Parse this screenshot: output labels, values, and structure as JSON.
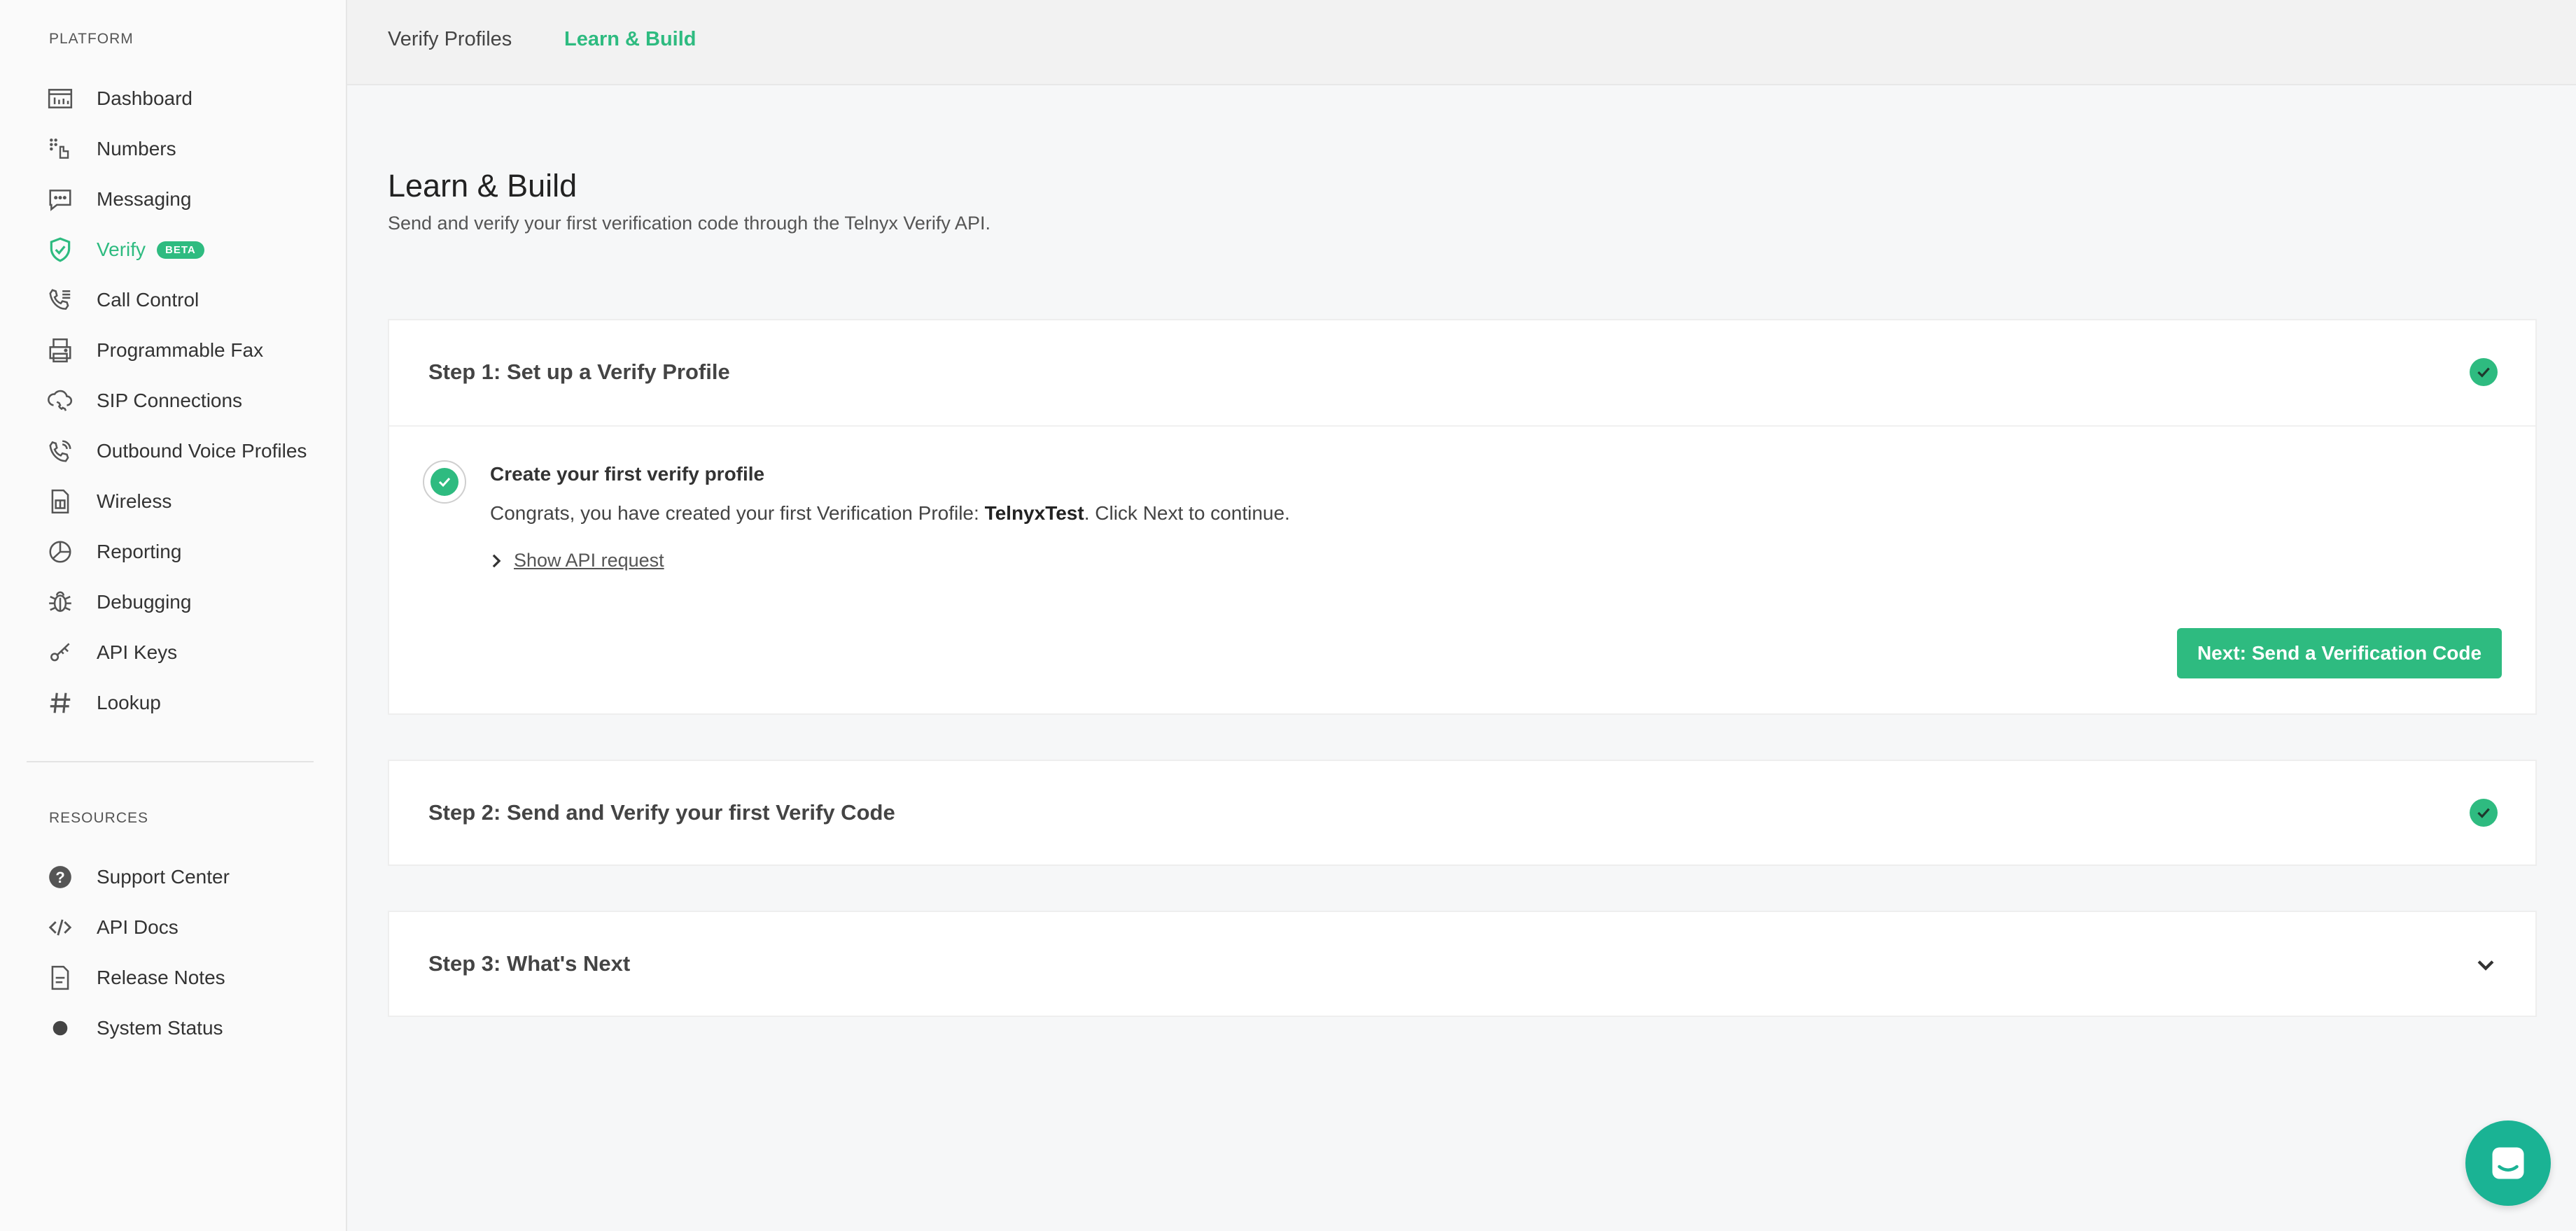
{
  "sidebar": {
    "platform_title": "PLATFORM",
    "items": [
      {
        "label": "Dashboard",
        "icon": "dashboard-icon"
      },
      {
        "label": "Numbers",
        "icon": "numbers-icon"
      },
      {
        "label": "Messaging",
        "icon": "messaging-icon"
      },
      {
        "label": "Verify",
        "icon": "verify-shield-icon",
        "badge": "BETA",
        "active": true
      },
      {
        "label": "Call Control",
        "icon": "call-control-icon"
      },
      {
        "label": "Programmable Fax",
        "icon": "fax-icon"
      },
      {
        "label": "SIP Connections",
        "icon": "sip-connections-icon"
      },
      {
        "label": "Outbound Voice Profiles",
        "icon": "outbound-voice-icon"
      },
      {
        "label": "Wireless",
        "icon": "wireless-sim-icon"
      },
      {
        "label": "Reporting",
        "icon": "reporting-pie-icon"
      },
      {
        "label": "Debugging",
        "icon": "debugging-bug-icon"
      },
      {
        "label": "API Keys",
        "icon": "api-keys-icon"
      },
      {
        "label": "Lookup",
        "icon": "lookup-hash-icon"
      }
    ],
    "resources_title": "RESOURCES",
    "resources": [
      {
        "label": "Support Center",
        "icon": "support-question-icon"
      },
      {
        "label": "API Docs",
        "icon": "code-icon"
      },
      {
        "label": "Release Notes",
        "icon": "document-icon"
      },
      {
        "label": "System Status",
        "icon": "status-dot-icon"
      }
    ]
  },
  "topbar": {
    "tabs": [
      {
        "label": "Verify Profiles"
      },
      {
        "label": "Learn & Build",
        "active": true
      }
    ]
  },
  "main": {
    "title": "Learn & Build",
    "subtitle": "Send and verify your first verification code through the Telnyx Verify API.",
    "steps": [
      {
        "title": "Step 1: Set up a Verify Profile",
        "status": "complete",
        "substep_title": "Create your first verify profile",
        "substep_text_before": "Congrats, you have created your first Verification Profile: ",
        "substep_profile_name": "TelnyxTest",
        "substep_text_after": ". Click Next to continue.",
        "api_toggle_label": "Show API request",
        "next_button_label": "Next: Send a Verification Code"
      },
      {
        "title": "Step 2: Send and Verify your first Verify Code",
        "status": "complete"
      },
      {
        "title": "Step 3: What's Next",
        "status": "collapsed"
      }
    ]
  },
  "colors": {
    "accent": "#2ebb80",
    "chat": "#1ab394"
  }
}
